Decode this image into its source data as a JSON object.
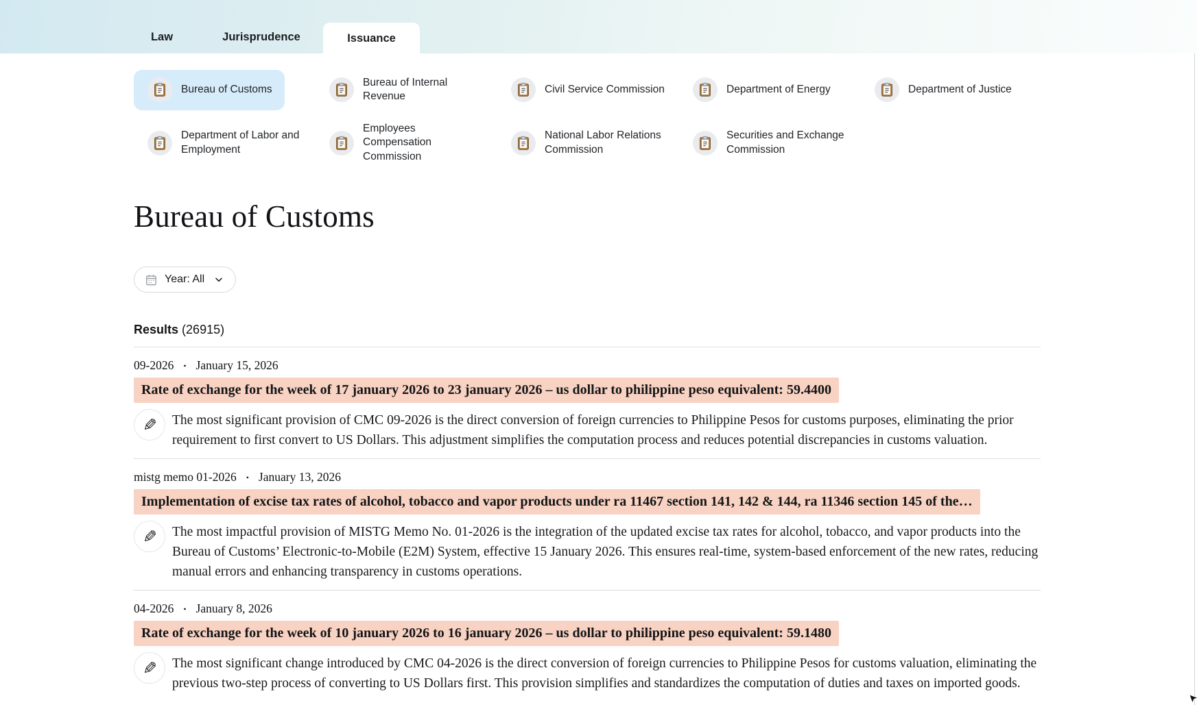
{
  "tabs": [
    {
      "label": "Law",
      "active": false
    },
    {
      "label": "Jurisprudence",
      "active": false
    },
    {
      "label": "Issuance",
      "active": true
    }
  ],
  "agencies": {
    "items": [
      {
        "label": "Bureau of Customs",
        "selected": true
      },
      {
        "label": "Bureau of Internal Revenue",
        "selected": false
      },
      {
        "label": "Civil Service Commission",
        "selected": false
      },
      {
        "label": "Department of Energy",
        "selected": false
      },
      {
        "label": "Department of Justice",
        "selected": false
      },
      {
        "label": "Department of Labor and Employment",
        "selected": false
      },
      {
        "label": "Employees Compensation Commission",
        "selected": false
      },
      {
        "label": "National Labor Relations Commission",
        "selected": false
      },
      {
        "label": "Securities and Exchange Commission",
        "selected": false
      }
    ]
  },
  "page": {
    "title": "Bureau of Customs"
  },
  "filter": {
    "label": "Year: All"
  },
  "glyphs": {
    "bullet": "•",
    "pen": "✎"
  },
  "colors": {
    "selected_agency_bg": "#d7ecfb",
    "highlight_bg": "#f8d2c2",
    "header_gradient_start": "#d3e9f1"
  },
  "results": {
    "label": "Results",
    "count": "(26915)",
    "items": [
      {
        "number": "09-2026",
        "date": "January 15, 2026",
        "title": "Rate of exchange for the week of 17 january 2026 to 23 january 2026 – us dollar to philippine peso equivalent: 59.4400",
        "summary": "The most significant provision of CMC 09-2026 is the direct conversion of foreign currencies to Philippine Pesos for customs purposes, eliminating the prior requirement to first convert to US Dollars. This adjustment simplifies the computation process and reduces potential discrepancies in customs valuation."
      },
      {
        "number": "mistg memo 01-2026",
        "date": "January 13, 2026",
        "title": "Implementation of excise tax rates of alcohol, tobacco and vapor products under ra 11467 section 141, 142 & 144, ra 11346 section 145 of the…",
        "summary": "The most impactful provision of MISTG Memo No. 01-2026 is the integration of the updated excise tax rates for alcohol, tobacco, and vapor products into the Bureau of Customs’ Electronic-to-Mobile (E2M) System, effective 15 January 2026. This ensures real-time, system-based enforcement of the new rates, reducing manual errors and enhancing transparency in customs operations."
      },
      {
        "number": "04-2026",
        "date": "January 8, 2026",
        "title": "Rate of exchange for the week of 10 january 2026 to 16 january 2026 – us dollar to philippine peso equivalent: 59.1480",
        "summary": "The most significant change introduced by CMC 04-2026 is the direct conversion of foreign currencies to Philippine Pesos for customs valuation, eliminating the previous two-step process of converting to US Dollars first. This provision simplifies and standardizes the computation of duties and taxes on imported goods."
      }
    ]
  }
}
